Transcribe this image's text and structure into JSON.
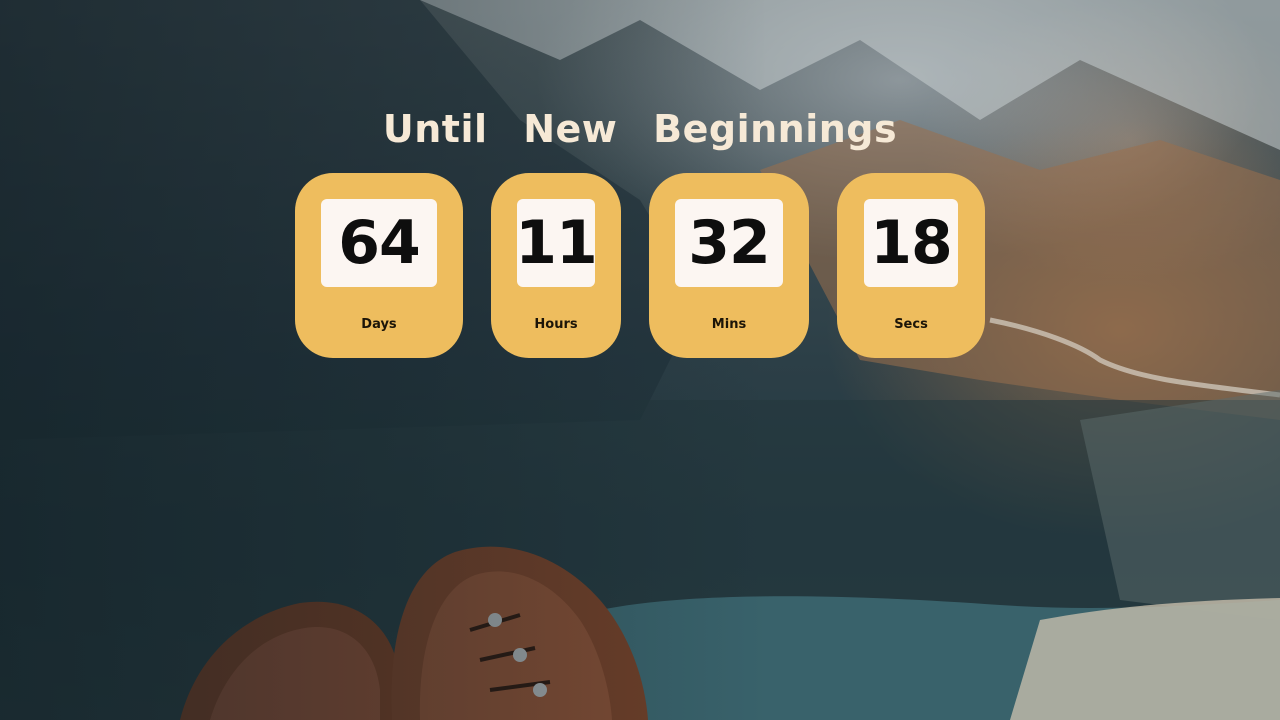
{
  "headline": {
    "words": [
      "Until",
      "New",
      "Beginnings"
    ]
  },
  "countdown": [
    {
      "value": "64",
      "label": "Days"
    },
    {
      "value": "11",
      "label": "Hours"
    },
    {
      "value": "32",
      "label": "Mins"
    },
    {
      "value": "18",
      "label": "Secs"
    }
  ],
  "colors": {
    "card": "#eebd5e",
    "number_box": "#fcf6f2",
    "headline": "#f6e9d6"
  }
}
